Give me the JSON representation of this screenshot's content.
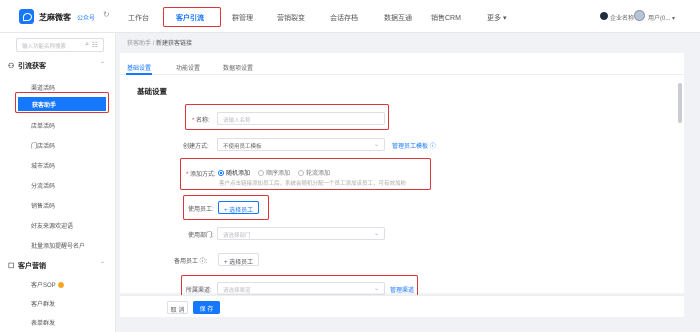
{
  "header": {
    "brand_name": "芝麻微客",
    "brand_sub": "公众号",
    "refresh_glyph": "↻",
    "nav": [
      "工作台",
      "客户引流",
      "群管理",
      "营销裂变",
      "会话存档",
      "数据互通",
      "销售CRM",
      "更多"
    ],
    "more_caret": "▾",
    "user_text": "企业名称",
    "user_name": "用户(0...",
    "user_caret": "▾"
  },
  "sidebar": {
    "search_placeholder": "输入功能名称搜索",
    "groups": [
      {
        "icon": "⚇",
        "label": "引流获客",
        "caret": "⌃"
      },
      {
        "icon": "☐",
        "label": "客户营销",
        "caret": "⌃"
      }
    ],
    "items": [
      "渠道活码",
      "获客助手",
      "店单活码",
      "门店活码",
      "城市活码",
      "分流活码",
      "销售活码",
      "好友来源欢迎语",
      "批量添加提醒号名户",
      "客户SOP",
      "客户群发",
      "表单群发"
    ]
  },
  "breadcrumb": {
    "parent": "获客助手",
    "sep": "/",
    "current": "新建获客链接"
  },
  "tabs": [
    "基础设置",
    "功能设置",
    "数据项设置"
  ],
  "form": {
    "section_title": "基础设置",
    "name_label": "名称:",
    "name_placeholder": "请输入名称",
    "creation_label": "创建方式:",
    "creation_value": "不使用员工模板",
    "creation_link": "管理员工模板",
    "add_method_label": "添加方式:",
    "add_methods": [
      "随机添加",
      "顺序添加",
      "轮流添加"
    ],
    "add_method_hint": "客户点击链接添加员工后，系统会随机分配一个员工添加该员工，可有效加粉",
    "staff_label": "使用员工:",
    "staff_button": "+ 选择员工",
    "dept_label": "使用部门:",
    "dept_placeholder": "请选择部门",
    "backup_label": "备用员工 ⓘ:",
    "backup_button": "+ 选择员工",
    "channel_label": "所属渠道:",
    "channel_placeholder": "请选择渠道",
    "channel_link": "管理渠道"
  },
  "footer": {
    "cancel": "取 消",
    "save": "保 存"
  }
}
